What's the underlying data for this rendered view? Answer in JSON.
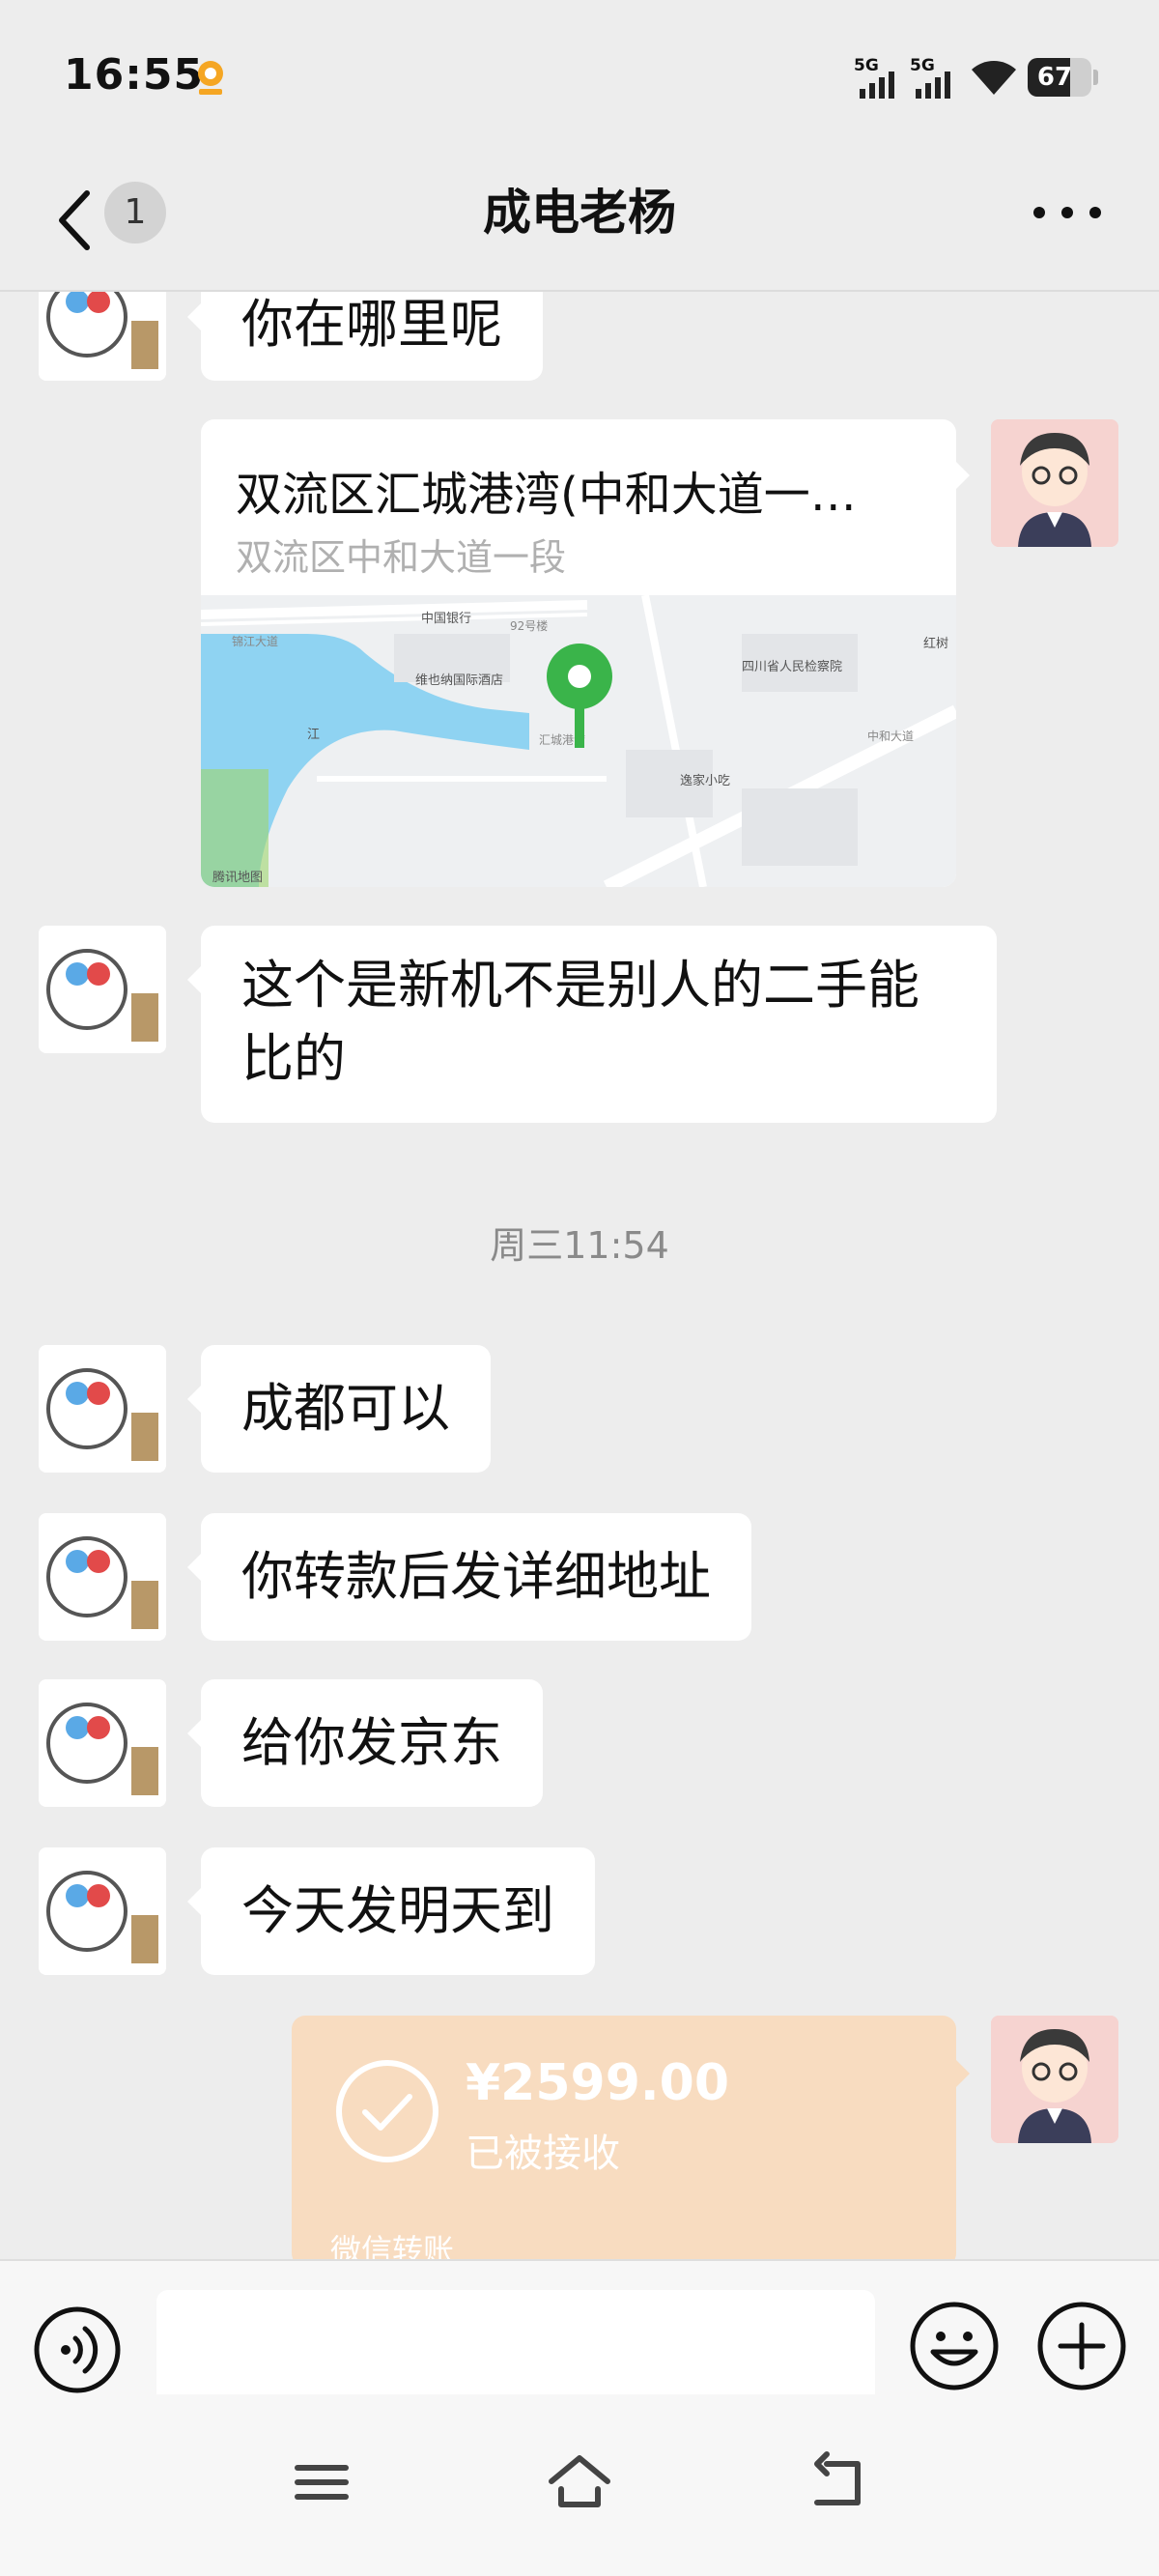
{
  "status_bar": {
    "time": "16:55",
    "sim1": "5G",
    "sim2": "5G",
    "battery": "67"
  },
  "header": {
    "unread_count": "1",
    "title": "成电老杨"
  },
  "messages": {
    "m1": "你在哪里呢",
    "location": {
      "title": "双流区汇城港湾(中和大道一…",
      "subtitle": "双流区中和大道一段",
      "map_labels": {
        "bank": "中国银行",
        "hotel": "维也纳国际酒店",
        "num92": "92号楼",
        "gov": "四川省人民检察院",
        "red": "红树",
        "restaurant": "逸家小吃",
        "harbor": "汇城港湾",
        "road": "中和大道",
        "river": "江",
        "attribution": "腾讯地图",
        "sign": "锦江大道"
      }
    },
    "m2": "这个是新机不是别人的二手能比的",
    "timestamp": "周三11:54",
    "m3": "成都可以",
    "m4": "你转款后发详细地址",
    "m5": "给你发京东",
    "m6": "今天发明天到",
    "transfer": {
      "amount": "¥2599.00",
      "status": "已被接收",
      "label": "微信转账"
    }
  },
  "colors": {
    "background": "#ededed",
    "bubble": "#ffffff",
    "transfer": "#f8dcc0",
    "pin": "#3ab44a"
  },
  "icons": [
    "back-icon",
    "more-icon",
    "voice-icon",
    "emoji-icon",
    "plus-icon",
    "menu-icon",
    "home-icon",
    "return-icon",
    "check-icon"
  ]
}
